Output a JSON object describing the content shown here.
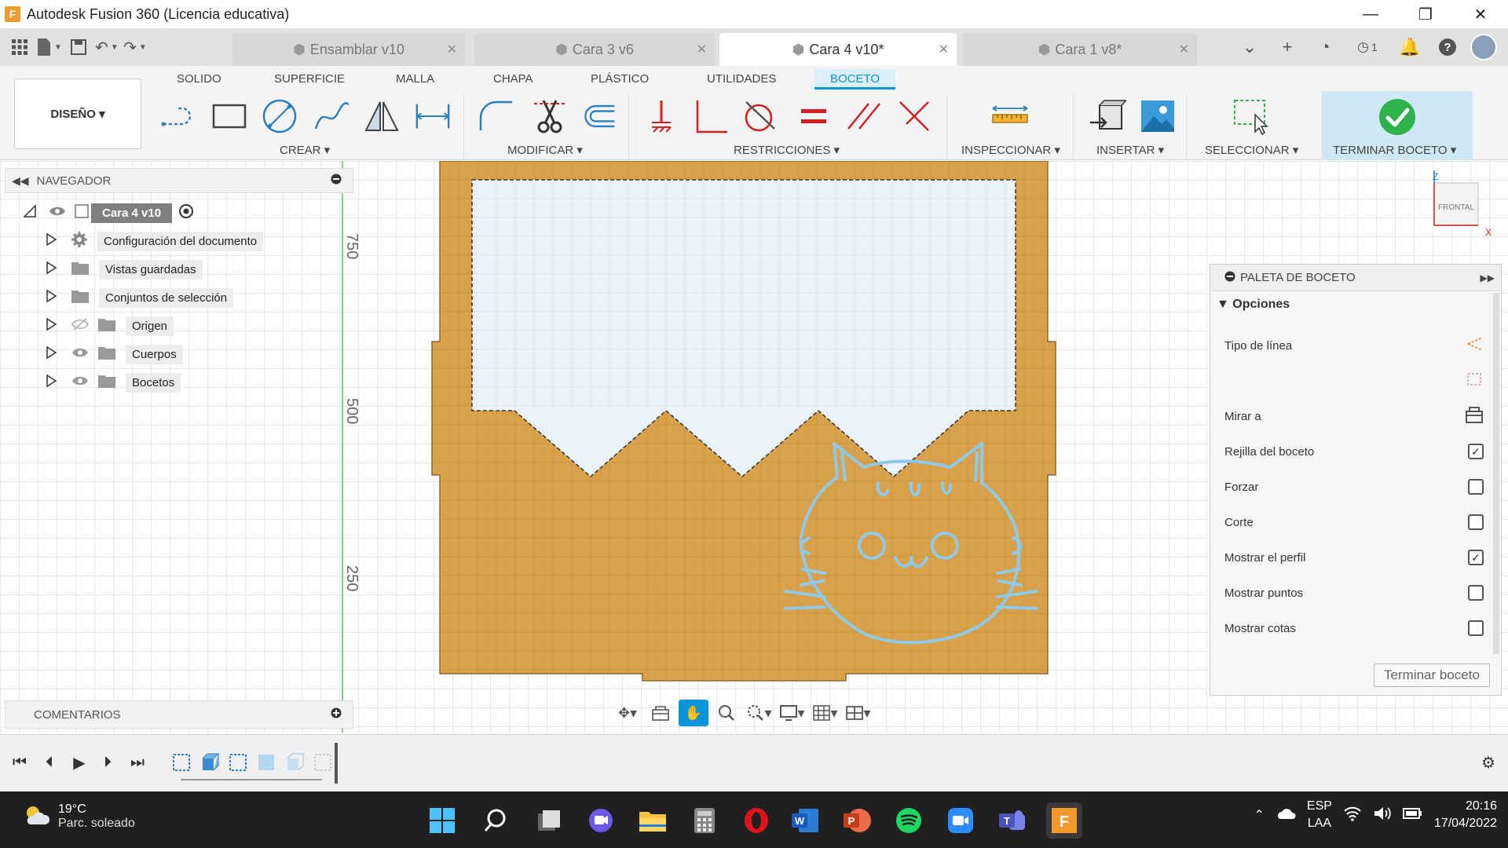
{
  "window": {
    "app_icon": "F",
    "title": "Autodesk Fusion 360 (Licencia educativa)",
    "minimize": "—",
    "restore": "❐",
    "close": "✕"
  },
  "doc_tabs": [
    {
      "label": "Ensamblar v10"
    },
    {
      "label": "Cara 3 v6"
    },
    {
      "label": "Cara 4 v10*"
    },
    {
      "label": "Cara 1 v8*"
    }
  ],
  "tab_right": {
    "job_count": "1"
  },
  "ribbon": {
    "tabs": [
      "SOLIDO",
      "SUPERFICIE",
      "MALLA",
      "CHAPA",
      "PLÁSTICO",
      "UTILIDADES",
      "BOCETO"
    ],
    "workspace": "DISEÑO ▾",
    "groups": [
      "CREAR ▾",
      "MODIFICAR ▾",
      "RESTRICCIONES ▾",
      "INSPECCIONAR ▾",
      "INSERTAR ▾",
      "SELECCIONAR ▾",
      "TERMINAR BOCETO ▾"
    ]
  },
  "navigator": {
    "header": "NAVEGADOR",
    "root": "Cara 4 v10",
    "items": [
      {
        "label": "Configuración del documento"
      },
      {
        "label": "Vistas guardadas"
      },
      {
        "label": "Conjuntos de selección"
      },
      {
        "label": "Origen"
      },
      {
        "label": "Cuerpos"
      },
      {
        "label": "Bocetos"
      }
    ]
  },
  "comments": {
    "label": "COMENTARIOS"
  },
  "ruler": {
    "ticks": [
      "750",
      "500",
      "250"
    ]
  },
  "viewcube": {
    "face": "FRONTAL",
    "z": "Z",
    "x": "X"
  },
  "palette": {
    "header": "PALETA DE BOCETO",
    "section": "Opciones",
    "rows": [
      {
        "label": "Tipo de línea",
        "control": "icon"
      },
      {
        "label": "",
        "control": "icon"
      },
      {
        "label": "Mirar a",
        "control": "icon"
      },
      {
        "label": "Rejilla del boceto",
        "checked": true
      },
      {
        "label": "Forzar",
        "checked": false
      },
      {
        "label": "Corte",
        "checked": false
      },
      {
        "label": "Mostrar el perfil",
        "checked": true
      },
      {
        "label": "Mostrar puntos",
        "checked": false
      },
      {
        "label": "Mostrar cotas",
        "checked": false
      }
    ],
    "finish_button": "Terminar boceto"
  },
  "taskbar": {
    "temperature": "19°C",
    "weather": "Parc. soleado",
    "lang_top": "ESP",
    "lang_bottom": "LAA",
    "time": "20:16",
    "date": "17/04/2022"
  },
  "colors": {
    "accent": "#0696d7",
    "panel_wood": "#d9a14a",
    "profile_fill": "#eaf2fb",
    "cat_stroke": "#8ec9e8",
    "finish_green": "#2fb14b"
  }
}
